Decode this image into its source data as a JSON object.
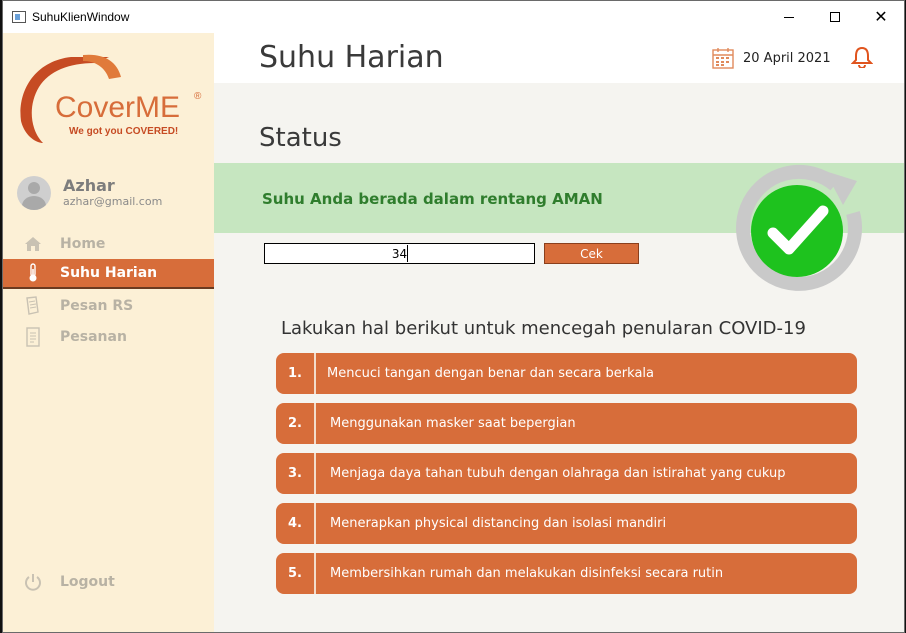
{
  "window": {
    "title": "SuhuKlienWindow"
  },
  "logo": {
    "brand": "CoverME",
    "registered": "®",
    "tagline": "We got you COVERED!",
    "color": "#d76d3a"
  },
  "user": {
    "name": "Azhar",
    "email": "azhar@gmail.com"
  },
  "sidebar": {
    "items": [
      {
        "label": "Home",
        "icon": "home-icon",
        "active": false
      },
      {
        "label": "Suhu Harian",
        "icon": "thermometer-icon",
        "active": true
      },
      {
        "label": "Pesan RS",
        "icon": "document-pen-icon",
        "active": false
      },
      {
        "label": "Pesanan",
        "icon": "list-document-icon",
        "active": false
      }
    ],
    "logout_label": "Logout"
  },
  "header": {
    "title": "Suhu Harian",
    "date": "20 April 2021"
  },
  "status": {
    "section_title": "Status",
    "message": "Suhu Anda berada dalam rentang AMAN",
    "banner_color": "#c6e6c0",
    "text_color": "#2f7d2d"
  },
  "temperature": {
    "value": "34",
    "button_label": "Cek"
  },
  "tips": {
    "title": "Lakukan hal berikut untuk mencegah penularan COVID-19",
    "items": [
      {
        "num": "1.",
        "text": "Mencuci tangan dengan benar dan secara berkala"
      },
      {
        "num": "2.",
        "text": "Menggunakan masker saat bepergian"
      },
      {
        "num": "3.",
        "text": "Menjaga daya tahan tubuh dengan olahraga dan istirahat yang cukup"
      },
      {
        "num": "4.",
        "text": "Menerapkan physical distancing dan isolasi mandiri"
      },
      {
        "num": "5.",
        "text": "Membersihkan rumah dan melakukan disinfeksi secara rutin"
      }
    ]
  },
  "colors": {
    "accent": "#d76d3a",
    "sidebar_bg": "#fcf0d6",
    "content_bg": "#f5f4f0"
  }
}
